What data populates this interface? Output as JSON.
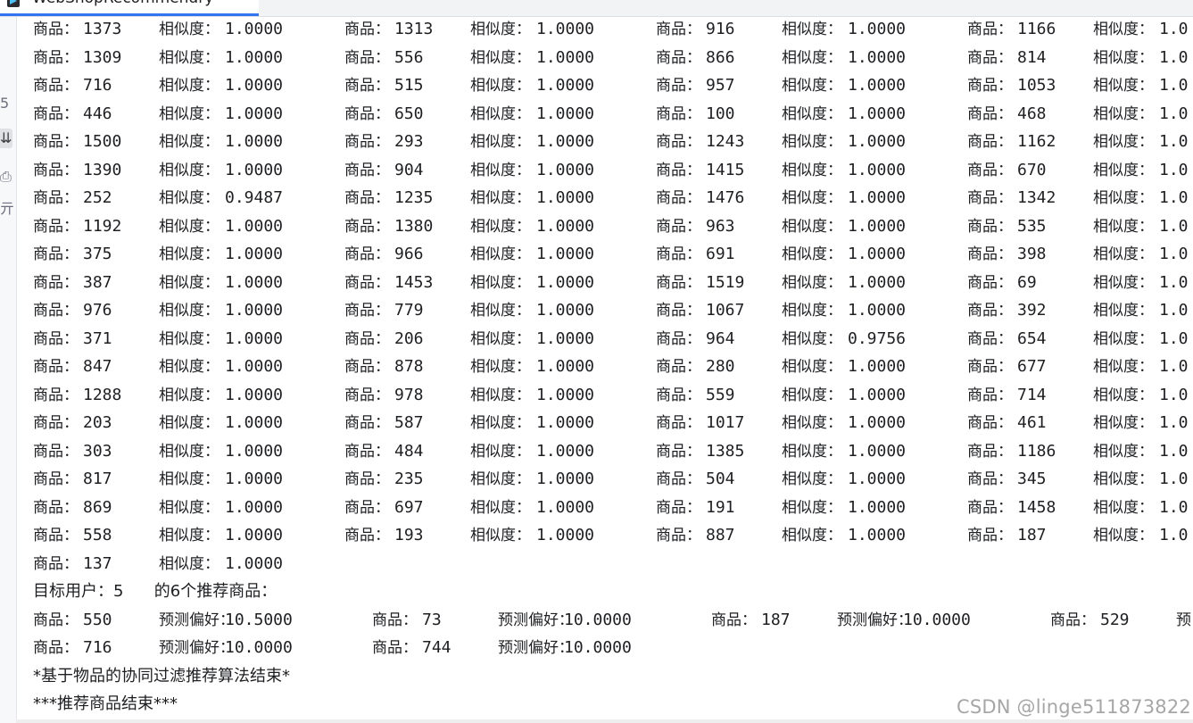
{
  "window": {
    "tab_title": "WebShopRecommendry"
  },
  "sidebar": {
    "icons": [
      {
        "name": "rerun-icon",
        "glyph": "5"
      },
      {
        "name": "download-icon",
        "glyph": "⇊"
      },
      {
        "name": "print-icon",
        "glyph": "⎙"
      },
      {
        "name": "delete-icon",
        "glyph": "亓"
      }
    ]
  },
  "console": {
    "item_label": "商品：",
    "sim_label": "相似度：",
    "similarity_rows": [
      [
        [
          "1373",
          "1.0000"
        ],
        [
          "1313",
          "1.0000"
        ],
        [
          "916",
          "1.0000"
        ],
        [
          "1166",
          "1.0"
        ]
      ],
      [
        [
          "1309",
          "1.0000"
        ],
        [
          "556",
          "1.0000"
        ],
        [
          "866",
          "1.0000"
        ],
        [
          "814",
          "1.0"
        ]
      ],
      [
        [
          "716",
          "1.0000"
        ],
        [
          "515",
          "1.0000"
        ],
        [
          "957",
          "1.0000"
        ],
        [
          "1053",
          "1.0"
        ]
      ],
      [
        [
          "446",
          "1.0000"
        ],
        [
          "650",
          "1.0000"
        ],
        [
          "100",
          "1.0000"
        ],
        [
          "468",
          "1.0"
        ]
      ],
      [
        [
          "1500",
          "1.0000"
        ],
        [
          "293",
          "1.0000"
        ],
        [
          "1243",
          "1.0000"
        ],
        [
          "1162",
          "1.0"
        ]
      ],
      [
        [
          "1390",
          "1.0000"
        ],
        [
          "904",
          "1.0000"
        ],
        [
          "1415",
          "1.0000"
        ],
        [
          "670",
          "1.0"
        ]
      ],
      [
        [
          "252",
          "0.9487"
        ],
        [
          "1235",
          "1.0000"
        ],
        [
          "1476",
          "1.0000"
        ],
        [
          "1342",
          "1.0"
        ]
      ],
      [
        [
          "1192",
          "1.0000"
        ],
        [
          "1380",
          "1.0000"
        ],
        [
          "963",
          "1.0000"
        ],
        [
          "535",
          "1.0"
        ]
      ],
      [
        [
          "375",
          "1.0000"
        ],
        [
          "966",
          "1.0000"
        ],
        [
          "691",
          "1.0000"
        ],
        [
          "398",
          "1.0"
        ]
      ],
      [
        [
          "387",
          "1.0000"
        ],
        [
          "1453",
          "1.0000"
        ],
        [
          "1519",
          "1.0000"
        ],
        [
          "69",
          "1.0"
        ]
      ],
      [
        [
          "976",
          "1.0000"
        ],
        [
          "779",
          "1.0000"
        ],
        [
          "1067",
          "1.0000"
        ],
        [
          "392",
          "1.0"
        ]
      ],
      [
        [
          "371",
          "1.0000"
        ],
        [
          "206",
          "1.0000"
        ],
        [
          "964",
          "0.9756"
        ],
        [
          "654",
          "1.0"
        ]
      ],
      [
        [
          "847",
          "1.0000"
        ],
        [
          "878",
          "1.0000"
        ],
        [
          "280",
          "1.0000"
        ],
        [
          "677",
          "1.0"
        ]
      ],
      [
        [
          "1288",
          "1.0000"
        ],
        [
          "978",
          "1.0000"
        ],
        [
          "559",
          "1.0000"
        ],
        [
          "714",
          "1.0"
        ]
      ],
      [
        [
          "203",
          "1.0000"
        ],
        [
          "587",
          "1.0000"
        ],
        [
          "1017",
          "1.0000"
        ],
        [
          "461",
          "1.0"
        ]
      ],
      [
        [
          "303",
          "1.0000"
        ],
        [
          "484",
          "1.0000"
        ],
        [
          "1385",
          "1.0000"
        ],
        [
          "1186",
          "1.0"
        ]
      ],
      [
        [
          "817",
          "1.0000"
        ],
        [
          "235",
          "1.0000"
        ],
        [
          "504",
          "1.0000"
        ],
        [
          "345",
          "1.0"
        ]
      ],
      [
        [
          "869",
          "1.0000"
        ],
        [
          "697",
          "1.0000"
        ],
        [
          "191",
          "1.0000"
        ],
        [
          "1458",
          "1.0"
        ]
      ],
      [
        [
          "558",
          "1.0000"
        ],
        [
          "193",
          "1.0000"
        ],
        [
          "887",
          "1.0000"
        ],
        [
          "187",
          "1.0"
        ]
      ],
      [
        [
          "137",
          "1.0000"
        ]
      ]
    ],
    "target_user_line": "目标用户：5      的6个推荐商品：",
    "pref_label": "预测偏好：",
    "recommend_rows": [
      [
        [
          "550",
          "10.5000"
        ],
        [
          "73",
          "10.0000"
        ],
        [
          "187",
          "10.0000"
        ],
        [
          "529",
          ""
        ]
      ],
      [
        [
          "716",
          "10.0000"
        ],
        [
          "744",
          "10.0000"
        ]
      ]
    ],
    "recommend_tail": "预",
    "end_line_1": "*基于物品的协同过滤推荐算法结束*",
    "end_line_2": "***推荐商品结束***"
  },
  "watermark": "CSDN @linge511873822"
}
